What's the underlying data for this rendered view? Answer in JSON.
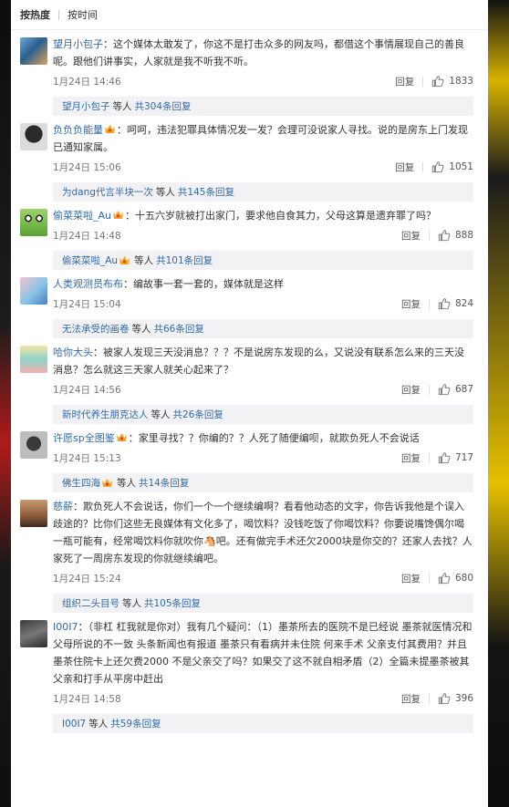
{
  "sort": {
    "hot": "按热度",
    "time": "按时间"
  },
  "like_icon": "thumbs-up-icon",
  "reply_label": "回复",
  "sub_text": "等人",
  "comments": [
    {
      "user": "望月小包子",
      "vip": false,
      "content": "：这个媒体太敢发了，你这不是打击众多的网友吗，都借这个事情展现自己的善良呢。跟他们讲事实，人家就是我不听我不听。",
      "time": "1月24日 14:46",
      "likes": "1833",
      "sub_user": "望月小包子",
      "sub_vip": false,
      "sub_count": "共304条回复"
    },
    {
      "user": "负负负能量",
      "vip": true,
      "content": "：呵呵，违法犯罪具体情况发一发？会理可没说家人寻找。说的是房东上门发现已通知家属。",
      "time": "1月24日 15:06",
      "likes": "1051",
      "sub_user": "为dang代言半块一次",
      "sub_vip": false,
      "sub_count": "共145条回复"
    },
    {
      "user": "偷菜菜啦_Au",
      "vip": true,
      "content": "：十五六岁就被打出家门，要求他自食其力，父母这算是遗弃罪了吗？",
      "time": "1月24日 14:48",
      "likes": "888",
      "sub_user": "偷菜菜啦_Au",
      "sub_vip": true,
      "sub_count": "共101条回复"
    },
    {
      "user": "人类观测员布布",
      "vip": false,
      "content": "：编故事一套一套的，媒体就是这样",
      "time": "1月24日 15:04",
      "likes": "824",
      "sub_user": "无法承受的画卷",
      "sub_vip": false,
      "sub_count": "共66条回复"
    },
    {
      "user": "哈你大头",
      "vip": false,
      "content": "：被家人发现三天没消息？？？不是说房东发现的么，又说没有联系怎么来的三天没消息？怎么就这三天家人就关心起来了？",
      "time": "1月24日 14:56",
      "likes": "687",
      "sub_user": "新时代养生朋克达人",
      "sub_vip": false,
      "sub_count": "共26条回复"
    },
    {
      "user": "许愿sp全图鉴",
      "vip": true,
      "content": "：家里寻找？？你编的？？人死了随便编呗，就欺负死人不会说话",
      "time": "1月24日 15:13",
      "likes": "717",
      "sub_user": "佛生四海",
      "sub_vip": true,
      "sub_count": "共14条回复"
    },
    {
      "user": "慈薪",
      "vip": false,
      "content": "：欺负死人不会说话，你们一个一个继续编啊？看看他动态的文字，你告诉我他是个误入歧途的？比你们这些无良媒体有文化多了，喝饮料？没钱吃饭了你喝饮料？你要说嘴馋偶尔喝一瓶可能有，经常喝饮料你就吹你🐴吧。还有做完手术还欠2000块是你交的？还家人去找？人家死了一周房东发现的你就继续编吧。",
      "time": "1月24日 15:24",
      "likes": "680",
      "sub_user": "组织二头目号",
      "sub_vip": false,
      "sub_count": "共105条回复"
    },
    {
      "user": "I00I7",
      "vip": false,
      "content": "：（非杠 杠我就是你对）我有几个疑问：（1）墨茶所去的医院不是已经说 墨茶就医情况和父母所说的不一致 头条新闻也有报道 墨茶只有看病并未住院 何来手术 父亲支付其费用？并且墨茶住院卡上还欠费2000 不是父亲交了吗？如果交了这不就自相矛盾（2）全篇未提墨茶被其父亲和打手从平房中赶出",
      "time": "1月24日 14:58",
      "likes": "396",
      "sub_user": "I00I7",
      "sub_vip": false,
      "sub_count": "共59条回复"
    }
  ]
}
